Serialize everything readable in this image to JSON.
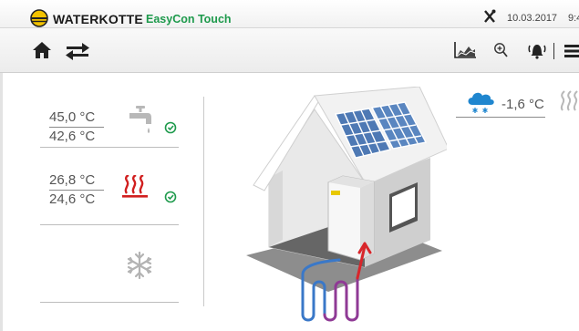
{
  "titlebar": {
    "brand": "WATERKOTTE",
    "product": "EasyCon Touch",
    "date": "10.03.2017",
    "time": "9:4"
  },
  "toolbar": {
    "icons": [
      "home-icon",
      "switch-arrows-icon",
      "chart-icon",
      "zoom-icon",
      "alarm-icon",
      "menu-icon"
    ]
  },
  "hot_water": {
    "actual": "45,0 °C",
    "target": "42,6 °C",
    "icon": "faucet-icon",
    "status_icon": "clock-icon"
  },
  "heating": {
    "actual": "26,8 °C",
    "target": "24,6 °C",
    "icon": "heating-icon",
    "status_icon": "clock-icon"
  },
  "cooling": {
    "icon": "snowflake-icon"
  },
  "outdoor": {
    "temperature": "-1,6 °C",
    "weather_icon": "cloud-snow-icon",
    "heat_icon": "heating-icon"
  },
  "colors": {
    "accent_green": "#1e9a4c",
    "heating_red": "#d11f1f",
    "weather_blue": "#1f86cf",
    "logo_yellow": "#f2c200"
  }
}
